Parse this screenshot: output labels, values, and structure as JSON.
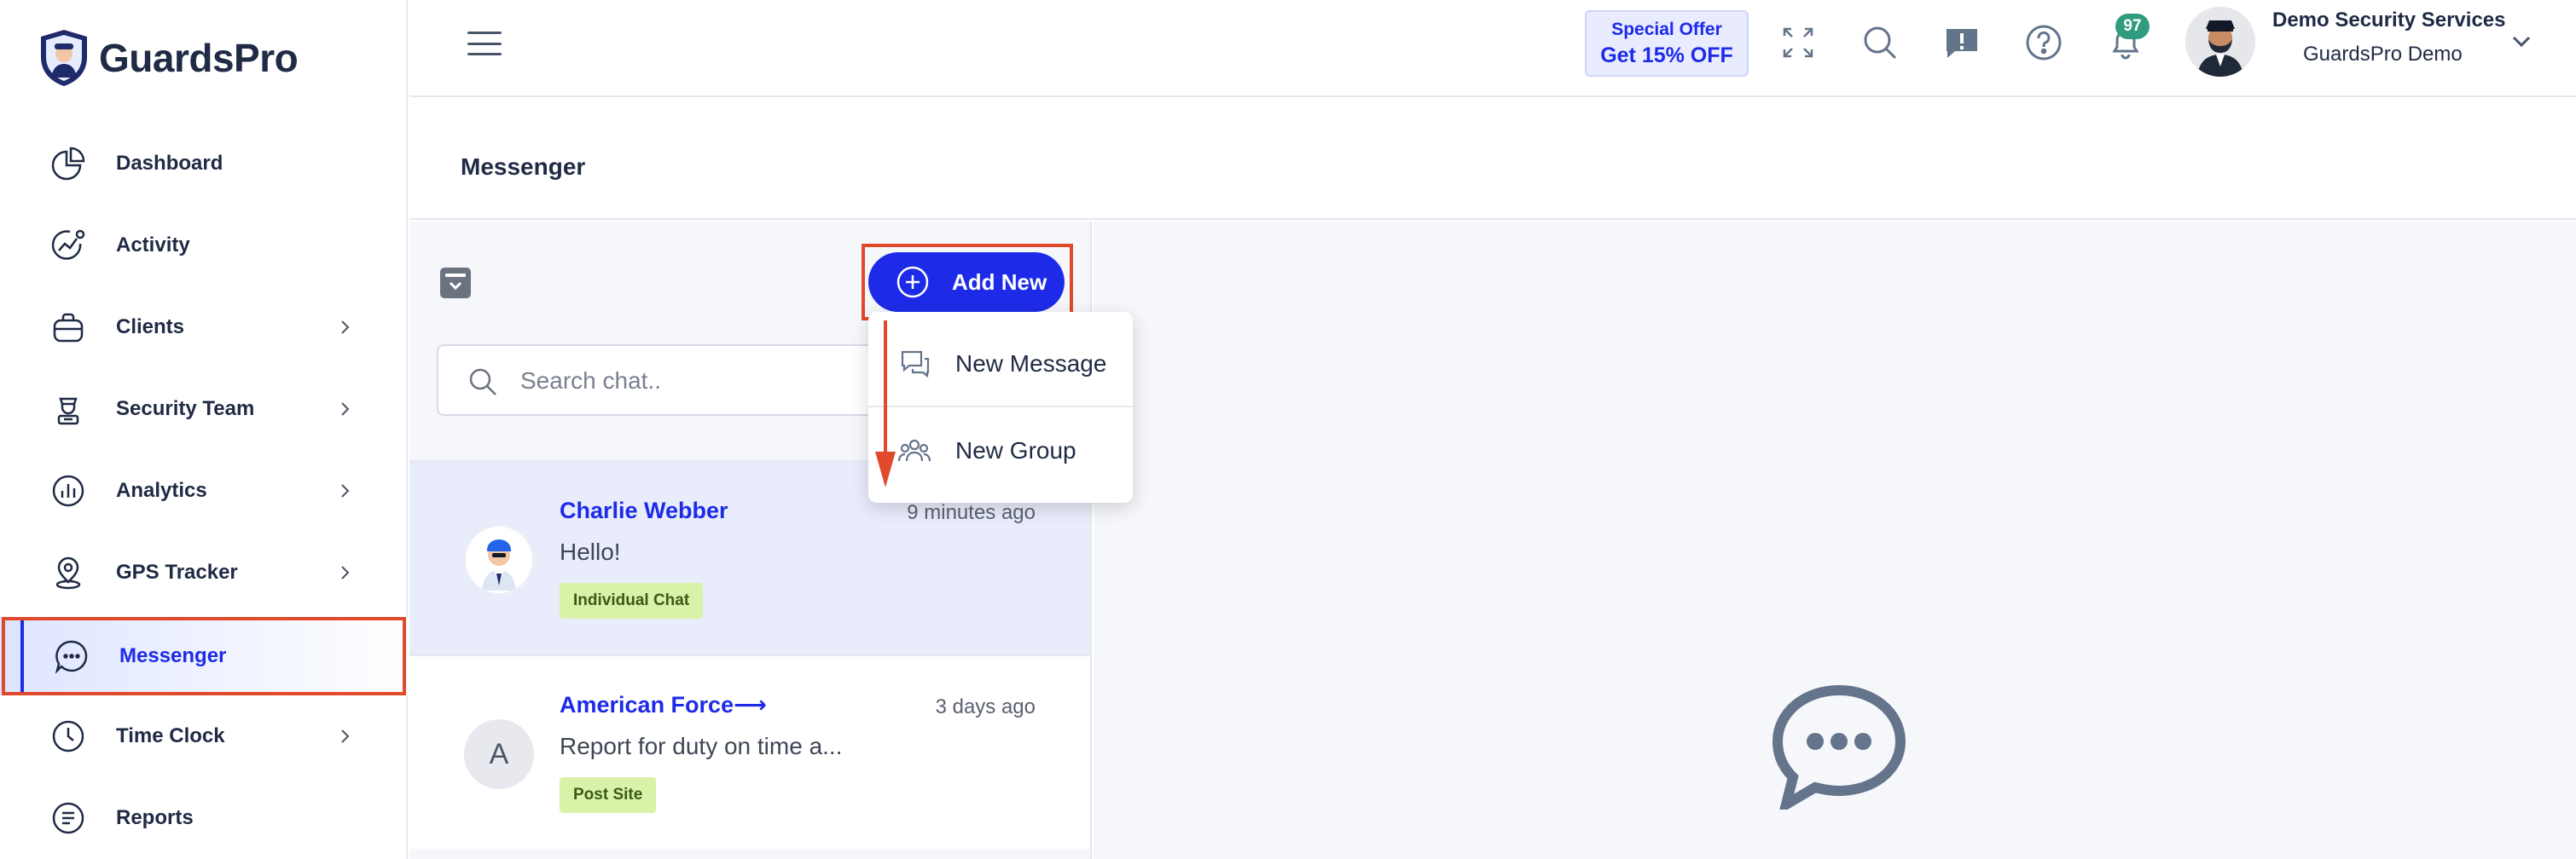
{
  "brand": {
    "name": "GuardsPro",
    "accent": "#1d2be8",
    "annotation": "#e04a2a"
  },
  "sidebar": {
    "items": [
      {
        "label": "Dashboard",
        "icon": "pie-chart-icon",
        "has_chevron": false
      },
      {
        "label": "Activity",
        "icon": "activity-icon",
        "has_chevron": false
      },
      {
        "label": "Clients",
        "icon": "briefcase-icon",
        "has_chevron": true
      },
      {
        "label": "Security Team",
        "icon": "guard-icon",
        "has_chevron": true
      },
      {
        "label": "Analytics",
        "icon": "analytics-icon",
        "has_chevron": true
      },
      {
        "label": "GPS Tracker",
        "icon": "map-pin-icon",
        "has_chevron": true
      },
      {
        "label": "Messenger",
        "icon": "chat-bubble-icon",
        "has_chevron": false,
        "active": true
      },
      {
        "label": "Time Clock",
        "icon": "clock-icon",
        "has_chevron": true
      },
      {
        "label": "Reports",
        "icon": "report-icon",
        "has_chevron": false
      }
    ]
  },
  "header": {
    "offer_top": "Special Offer",
    "offer_bottom": "Get 15% OFF",
    "notification_count": "97",
    "user_name": "Demo Security Services",
    "user_org": "GuardsPro Demo"
  },
  "page": {
    "title": "Messenger"
  },
  "chat_list": {
    "add_new_label": "Add New",
    "search_placeholder": "Search chat..",
    "chats": [
      {
        "name": "Charlie Webber",
        "time": "9 minutes ago",
        "preview": "Hello!",
        "tag": "Individual Chat"
      },
      {
        "name": "American Force⟶",
        "time": "3 days ago",
        "preview": "Report for duty on time a...",
        "tag": "Post Site",
        "initial": "A"
      }
    ]
  },
  "dropdown": {
    "items": [
      {
        "label": "New Message",
        "icon": "new-message-icon"
      },
      {
        "label": "New Group",
        "icon": "group-icon"
      }
    ]
  }
}
